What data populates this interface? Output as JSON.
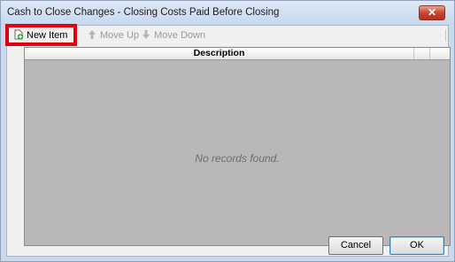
{
  "window": {
    "title": "Cash to Close Changes - Closing Costs Paid Before Closing",
    "close_label": "✕"
  },
  "toolbar": {
    "new_item": "New Item",
    "move_up": "Move Up",
    "move_down": "Move Down"
  },
  "grid": {
    "columns": [
      "Description"
    ],
    "empty_message": "No records found."
  },
  "buttons": {
    "cancel": "Cancel",
    "ok": "OK"
  },
  "colors": {
    "highlight": "#e0000f",
    "grid_bg": "#b8b8b8",
    "close": "#c8472f"
  },
  "icons": {
    "new_item": "add-document-icon",
    "move_up": "arrow-up-icon",
    "move_down": "arrow-down-icon"
  }
}
